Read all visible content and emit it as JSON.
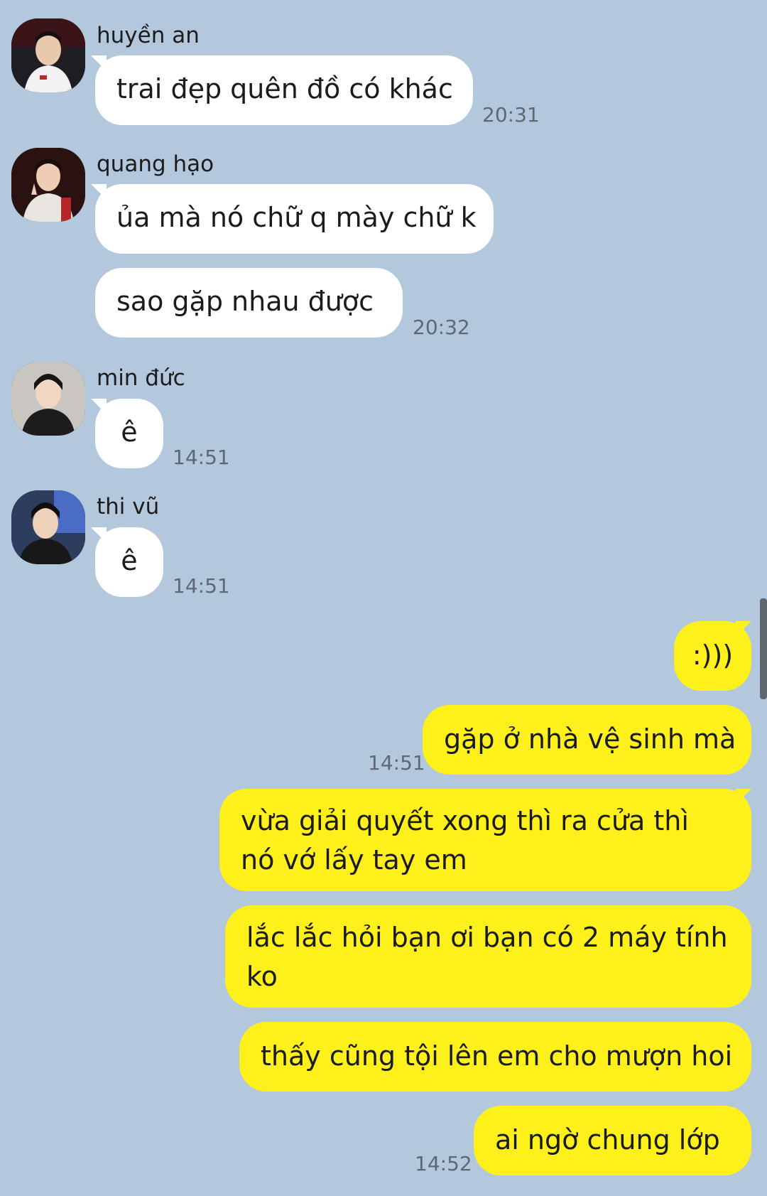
{
  "messages": [
    {
      "sender": "huyền an",
      "text": "trai đẹp quên đồ có khác",
      "time": "20:31",
      "avatar": "avatar-huyen-an"
    },
    {
      "sender": "quang hạo",
      "text1": "ủa mà nó chữ q mày chữ k",
      "text2": "sao gặp nhau được",
      "time": "20:32",
      "avatar": "avatar-quang-hao"
    },
    {
      "sender": "min đức",
      "text": "ê",
      "time": "14:51",
      "avatar": "avatar-min-duc"
    },
    {
      "sender": "thi vũ",
      "text": "ê",
      "time": "14:51",
      "avatar": "avatar-thi-vu"
    }
  ],
  "outgoing": {
    "m1": ":)))",
    "m2": "gặp ở nhà vệ sinh mà",
    "m2_time": "14:51",
    "m3": "vừa giải quyết xong thì ra cửa thì nó vớ lấy tay em",
    "m4": "lắc lắc hỏi bạn ơi bạn có 2 máy tính ko",
    "m5": "thấy cũng tội lên em cho mượn hoi",
    "m6": "ai ngờ chung lớp",
    "m6_time": "14:52"
  },
  "colors": {
    "background": "#b3c8dc",
    "incoming_bubble": "#ffffff",
    "outgoing_bubble": "#fef01b"
  }
}
